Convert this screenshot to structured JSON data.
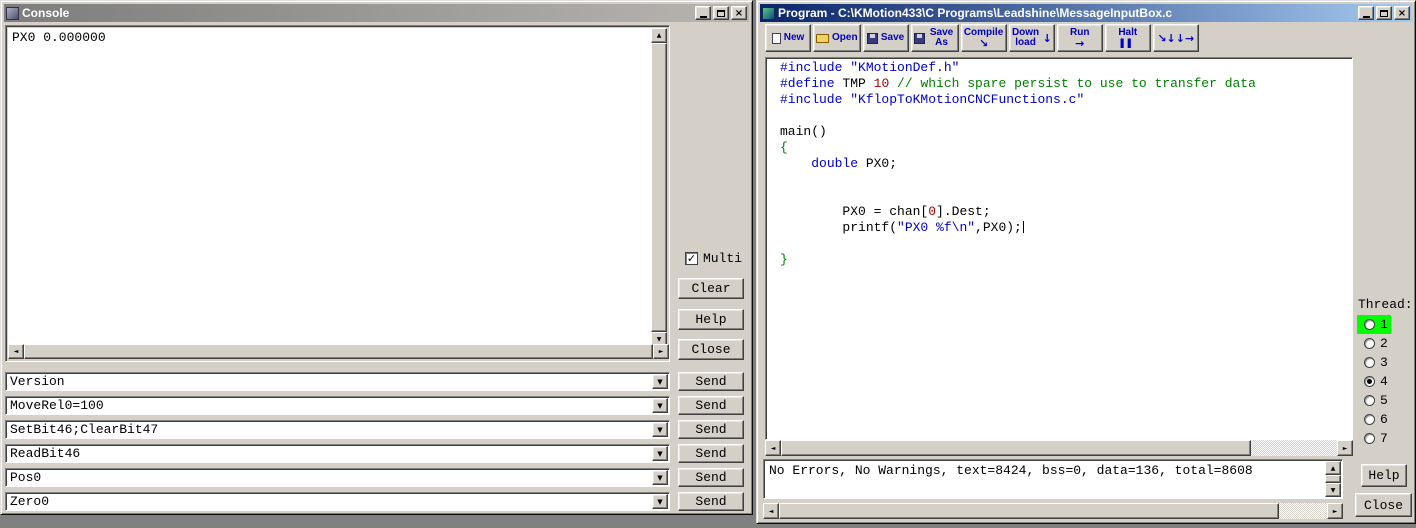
{
  "icons": {
    "scroll_up": "▲",
    "scroll_down": "▼",
    "scroll_left": "◄",
    "scroll_right": "►",
    "dropdown": "▼",
    "check": "✓",
    "close": "×",
    "run_arrow": "→",
    "down_arrow": "↓",
    "compile_arrow": "↘",
    "halt_bars": "▌▌",
    "step_arrows": "↘↓↓→"
  },
  "console": {
    "title": "Console",
    "output_text": "PX0 0.000000",
    "multi_label": "Multi",
    "clear_label": "Clear",
    "help_label": "Help",
    "close_label": "Close",
    "send_label": "Send",
    "commands": [
      "Version",
      "MoveRel0=100",
      "SetBit46;ClearBit47",
      "ReadBit46",
      "Pos0",
      "Zero0"
    ]
  },
  "program": {
    "title": "Program - C:\\KMotion433\\C Programs\\Leadshine\\MessageInputBox.c",
    "toolbar": [
      {
        "label": "New",
        "icon": "new-page-icon"
      },
      {
        "label": "Open",
        "icon": "open-folder-icon"
      },
      {
        "label": "Save",
        "icon": "save-floppy-icon"
      },
      {
        "label": "Save As",
        "icon": "save-as-floppy-icon"
      },
      {
        "label": "Compile",
        "icon": "compile-arrow-icon"
      },
      {
        "label": "Down load",
        "icon": "download-arrow-icon"
      },
      {
        "label": "Run",
        "icon": "run-arrow-icon"
      },
      {
        "label": "Halt",
        "icon": "halt-pause-icon"
      },
      {
        "label": "",
        "icon": "step-arrows-icon"
      }
    ],
    "code": {
      "colors": {
        "directive": "#0000cc",
        "keyword": "#0000cc",
        "string": "#0000cc",
        "comment": "#008000",
        "number": "#aa0000",
        "brace": "#008000",
        "plain": "#000000"
      },
      "lines": [
        [
          {
            "t": "directive",
            "s": "#include "
          },
          {
            "t": "string",
            "s": "\"KMotionDef.h\""
          }
        ],
        [
          {
            "t": "directive",
            "s": "#define "
          },
          {
            "t": "plain",
            "s": "TMP "
          },
          {
            "t": "number",
            "s": "10 "
          },
          {
            "t": "comment",
            "s": "// which spare persist to use to transfer data"
          }
        ],
        [
          {
            "t": "directive",
            "s": "#include "
          },
          {
            "t": "string",
            "s": "\"KflopToKMotionCNCFunctions.c\""
          }
        ],
        [],
        [
          {
            "t": "plain",
            "s": "main()"
          }
        ],
        [
          {
            "t": "brace",
            "s": "{"
          }
        ],
        [
          {
            "t": "plain",
            "s": "    "
          },
          {
            "t": "keyword",
            "s": "double"
          },
          {
            "t": "plain",
            "s": " PX0;"
          }
        ],
        [],
        [],
        [
          {
            "t": "plain",
            "s": "        PX0 = chan["
          },
          {
            "t": "number",
            "s": "0"
          },
          {
            "t": "plain",
            "s": "].Dest;"
          }
        ],
        [
          {
            "t": "plain",
            "s": "        printf("
          },
          {
            "t": "string",
            "s": "\"PX0 %f\\n\""
          },
          {
            "t": "plain",
            "s": ",PX0);"
          },
          {
            "t": "caret",
            "s": ""
          }
        ],
        [],
        [
          {
            "t": "brace",
            "s": "}"
          }
        ]
      ]
    },
    "thread_panel": {
      "label": "Thread:",
      "options": [
        "1",
        "2",
        "3",
        "4",
        "5",
        "6",
        "7"
      ],
      "selected": "4",
      "active_highlight": "1",
      "highlight_color": "#00ff00"
    },
    "status_text": "No Errors, No Warnings, text=8424, bss=0, data=136, total=8608",
    "help_label": "Help",
    "close_label": "Close"
  }
}
